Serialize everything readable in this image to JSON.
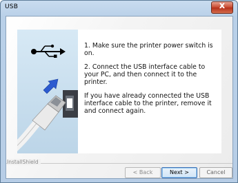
{
  "window": {
    "title": "USB",
    "close_glyph": "x"
  },
  "instructions": {
    "step1": "1. Make sure the printer power switch is on.",
    "step2": "2. Connect the USB interface cable to your PC, and then connect it to the printer.",
    "note": "If you have already connected the USB interface cable to the printer, remove it and connect again."
  },
  "footer": {
    "brand": "InstallShield"
  },
  "buttons": {
    "back": "< Back",
    "next": "Next >",
    "cancel": "Cancel"
  },
  "colors": {
    "title_gradient": "#c9dcef",
    "close_red": "#c6452c",
    "arrow_blue": "#2b5ad0",
    "image_pane": "#cfe3f2"
  },
  "icons": [
    "usb-symbol-icon",
    "arrow-right-icon",
    "usb-cable-illustration"
  ]
}
